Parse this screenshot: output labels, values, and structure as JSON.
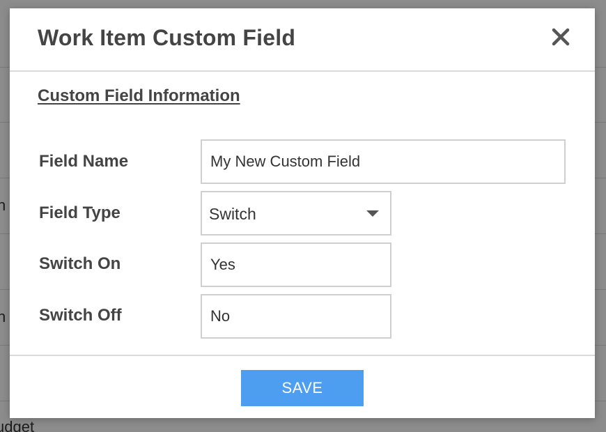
{
  "background": {
    "partial_texts": [
      "n",
      "n",
      "udget"
    ]
  },
  "dialog": {
    "title": "Work Item Custom Field",
    "close_icon": "close-icon",
    "section_heading": "Custom Field Information",
    "fields": {
      "field_name": {
        "label": "Field Name",
        "value": "My New Custom Field"
      },
      "field_type": {
        "label": "Field Type",
        "value": "Switch"
      },
      "switch_on": {
        "label": "Switch On",
        "value": "Yes"
      },
      "switch_off": {
        "label": "Switch Off",
        "value": "No"
      }
    },
    "save_label": "SAVE"
  },
  "colors": {
    "accent": "#4d9ef0",
    "title_text": "#444444",
    "border": "#cfcfcf",
    "backdrop": "#8e8e91"
  }
}
